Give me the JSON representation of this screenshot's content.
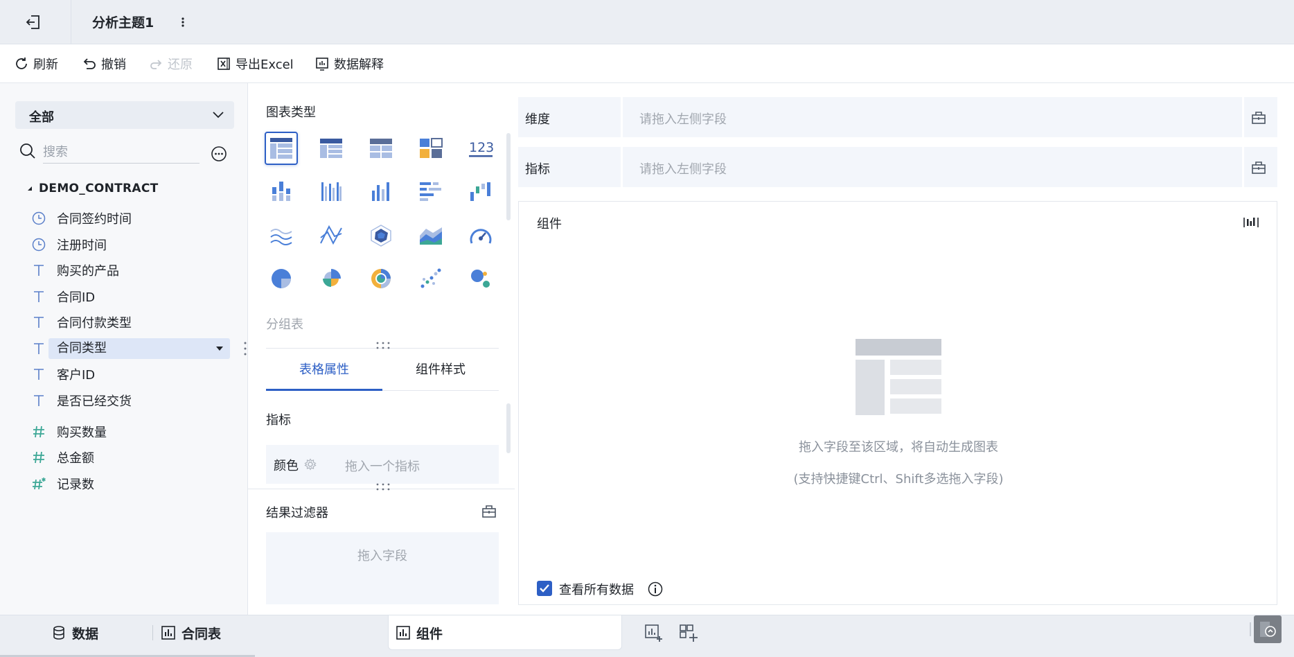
{
  "app": {
    "title": "分析主题1"
  },
  "toolbar": {
    "refresh": "刷新",
    "undo": "撤销",
    "redo": "还原",
    "export_excel": "导出Excel",
    "data_explain": "数据解释"
  },
  "left_panel": {
    "dataset_select": "全部",
    "search_placeholder": "搜索",
    "table_name": "DEMO_CONTRACT",
    "fields": [
      {
        "label": "合同签约时间",
        "type": "date"
      },
      {
        "label": "注册时间",
        "type": "date"
      },
      {
        "label": "购买的产品",
        "type": "text"
      },
      {
        "label": "合同ID",
        "type": "text"
      },
      {
        "label": "合同付款类型",
        "type": "text"
      },
      {
        "label": "合同类型",
        "type": "text",
        "selected": true
      },
      {
        "label": "客户ID",
        "type": "text"
      },
      {
        "label": "是否已经交货",
        "type": "text"
      },
      {
        "label": "购买数量",
        "type": "number"
      },
      {
        "label": "总金额",
        "type": "number"
      },
      {
        "label": "记录数",
        "type": "number-calc"
      }
    ]
  },
  "chart_panel": {
    "title": "图表类型",
    "selected_type": "分组表",
    "chart_types": [
      "grouped-table-icon",
      "cross-table-icon",
      "detail-table-icon",
      "kpi-card-icon",
      "number-icon",
      "stacked-bar-icon",
      "grouped-bar-icon",
      "bar-chart-icon",
      "horizontal-bar-icon",
      "waterfall-icon",
      "line-chart-icon",
      "polyline-icon",
      "radar-icon",
      "area-chart-icon",
      "gauge-icon",
      "pie-chart-icon",
      "rose-chart-icon",
      "sunburst-icon",
      "scatter-icon",
      "bubble-icon"
    ],
    "tabs": [
      "表格属性",
      "组件样式"
    ],
    "metric_label": "指标",
    "color_label": "颜色",
    "color_placeholder": "拖入一个指标",
    "filter_label": "结果过滤器",
    "filter_placeholder": "拖入字段"
  },
  "editor": {
    "dimension_label": "维度",
    "dimension_placeholder": "请拖入左侧字段",
    "metric_label": "指标",
    "metric_placeholder": "请拖入左侧字段",
    "canvas_title": "组件",
    "empty_line1": "拖入字段至该区域，将自动生成图表",
    "empty_line2": "(支持快捷键Ctrl、Shift多选拖入字段)",
    "view_all_data": "查看所有数据"
  },
  "bottom_tabs": {
    "data": "数据",
    "contract_table": "合同表",
    "component": "组件"
  },
  "colors": {
    "accent": "#2d5fc5",
    "field_icon": "#5a7fc9",
    "number_icon": "#3ca796"
  }
}
